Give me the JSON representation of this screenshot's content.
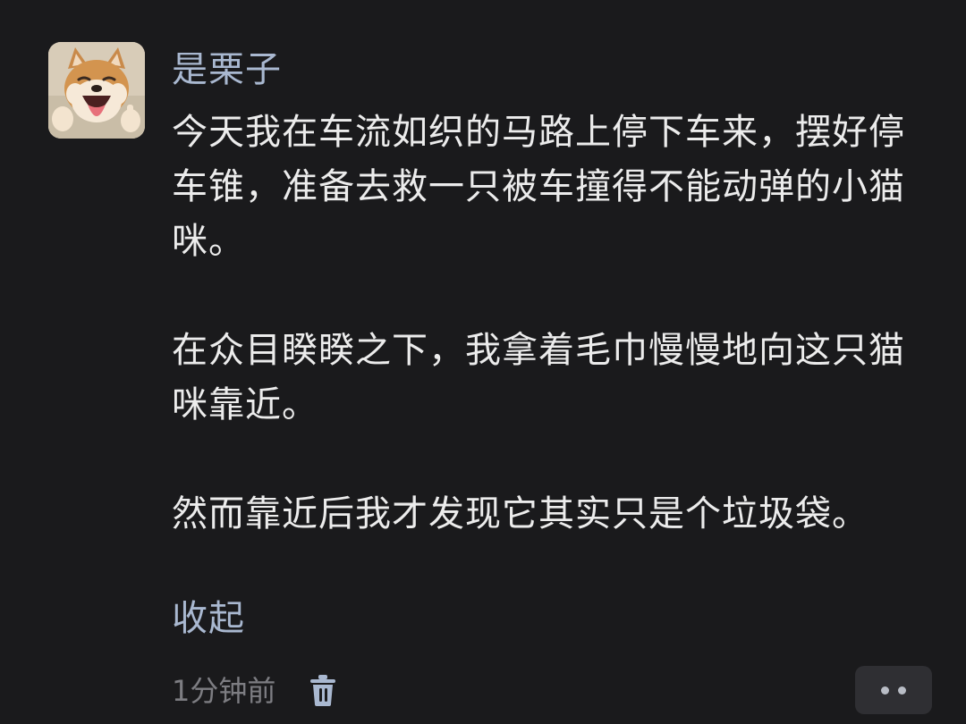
{
  "comment": {
    "username": "是栗子",
    "paragraphs": [
      "今天我在车流如织的马路上停下车来，摆好停车锥，准备去救一只被车撞得不能动弹的小猫咪。",
      "在众目睽睽之下，我拿着毛巾慢慢地向这只猫咪靠近。",
      "然而靠近后我才发现它其实只是个垃圾袋。"
    ],
    "collapse_label": "收起",
    "timestamp": "1分钟前"
  },
  "icons": {
    "avatar": "shiba-dog-avatar",
    "delete": "trash-icon",
    "more": "more-dots-icon"
  },
  "colors": {
    "background": "#1a1a1c",
    "username": "#a9b8d0",
    "body_text": "#ececec",
    "meta_text": "#7d7d82"
  }
}
